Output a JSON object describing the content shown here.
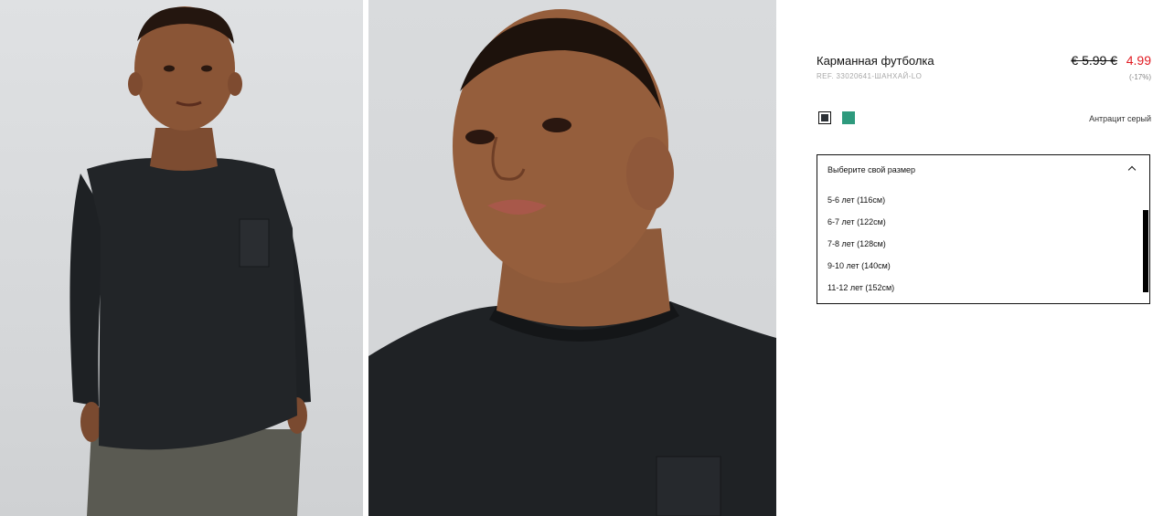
{
  "product": {
    "title": "Карманная футболка",
    "ref": "REF. 33020641-ШАНХАЙ-LO",
    "price_old": "€ 5.99 €",
    "price_new": "4.99",
    "discount": "(-17%)",
    "color_name": "Антрацит серый",
    "colors": [
      "#2b3035",
      "#2e9a7d"
    ]
  },
  "size_select": {
    "placeholder": "Выберите свой размер",
    "options": [
      "5-6 лет (116см)",
      "6-7 лет (122см)",
      "7-8 лет (128см)",
      "9-10 лет (140см)",
      "11-12 лет (152см)"
    ]
  },
  "images": {
    "photo_1": "boy in black long-sleeve t-shirt, full front view",
    "photo_2": "boy in black t-shirt, face close-up"
  },
  "accent": {
    "sale_red": "#e11b22"
  }
}
